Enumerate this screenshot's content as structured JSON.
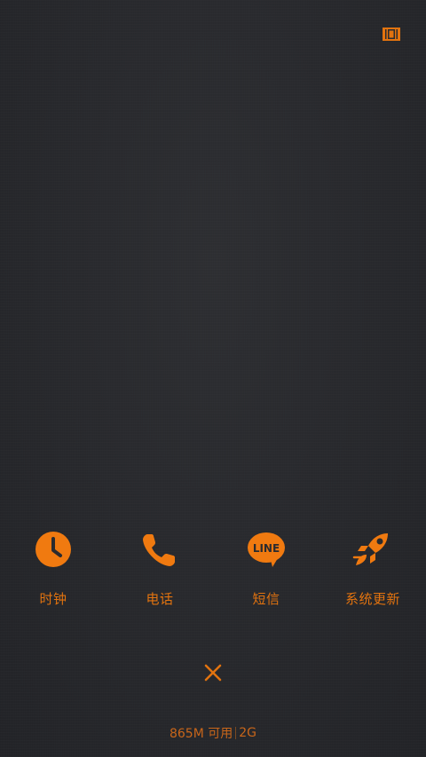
{
  "colors": {
    "accent": "#f07a10",
    "label": "#e2730f",
    "background": "#2a2b2f"
  },
  "top_right": {
    "icon": "multi-window-icon"
  },
  "recent_apps": [
    {
      "label": "时钟",
      "icon": "clock-icon"
    },
    {
      "label": "电话",
      "icon": "phone-icon"
    },
    {
      "label": "短信",
      "icon": "line-message-icon",
      "icon_text": "LINE"
    },
    {
      "label": "系统更新",
      "icon": "rocket-icon"
    }
  ],
  "close": {
    "icon": "close-icon"
  },
  "memory": {
    "available": "865M 可用",
    "total": "2G"
  }
}
